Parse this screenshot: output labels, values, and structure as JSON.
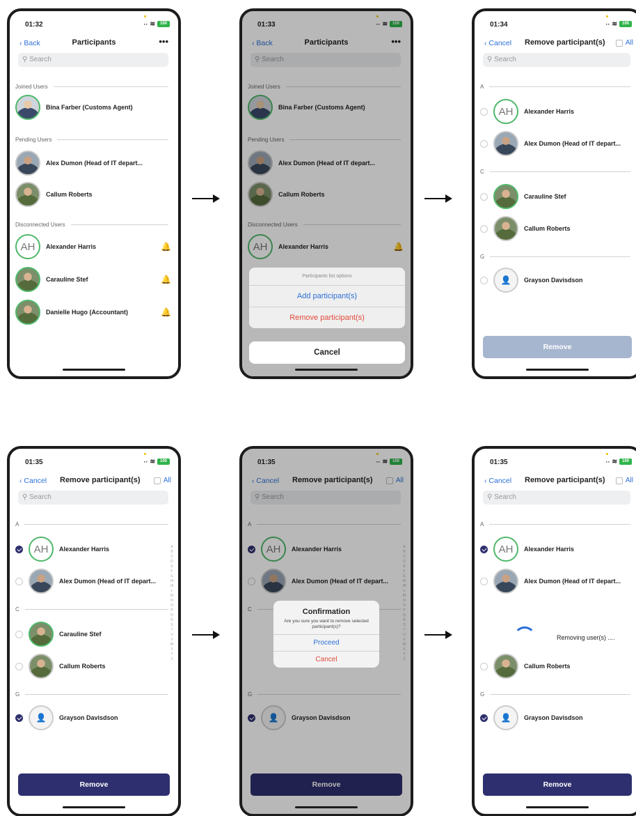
{
  "battery": "100",
  "screens": [
    {
      "time": "01:32",
      "back": "Back",
      "title": "Participants",
      "more": "•••",
      "search": "Search",
      "sections": {
        "joined": "Joined Users",
        "pending": "Pending Users",
        "disconnected": "Disconnected Users"
      },
      "users": [
        "Bina Farber (Customs Agent)",
        "Alex Dumon  (Head of IT depart...",
        "Callum Roberts",
        "Alexander Harris",
        "Carauline Stef",
        "Danielle Hugo  (Accountant)"
      ],
      "initials": "AH"
    },
    {
      "time": "01:33",
      "back": "Back",
      "title": "Participants",
      "more": "•••",
      "search": "Search",
      "sections": {
        "joined": "Joined Users",
        "pending": "Pending Users",
        "disconnected": "Disconnected Users"
      },
      "users": [
        "Bina Farber (Customs Agent)",
        "Alex Dumon  (Head of IT depart...",
        "Callum Roberts",
        "Alexander Harris"
      ],
      "initials": "AH",
      "sheet": {
        "title": "Participants list options",
        "add": "Add participant(s)",
        "remove": "Remove participant(s)",
        "cancel": "Cancel"
      }
    },
    {
      "time": "01:34",
      "back": "Cancel",
      "title": "Remove participant(s)",
      "all": "All",
      "search": "Search",
      "letters": [
        "A",
        "C",
        "G"
      ],
      "users": [
        "Alexander Harris",
        "Alex Dumon  (Head of IT depart...",
        "Carauline Stef",
        "Callum Roberts",
        "Grayson Davisdson"
      ],
      "initials": "AH",
      "button": "Remove"
    },
    {
      "time": "01:35",
      "back": "Cancel",
      "title": "Remove participant(s)",
      "all": "All",
      "search": "Search",
      "letters": [
        "A",
        "C",
        "G"
      ],
      "users": [
        "Alexander Harris",
        "Alex Dumon  (Head of IT depart...",
        "Carauline Stef",
        "Callum Roberts",
        "Grayson Davisdson"
      ],
      "initials": "AH",
      "button": "Remove",
      "alpha": "ABCDEFGHIJKLMNOPQRSTUVWXYZ"
    },
    {
      "time": "01:35",
      "back": "Cancel",
      "title": "Remove participant(s)",
      "all": "All",
      "search": "Search",
      "letters": [
        "A",
        "C",
        "G"
      ],
      "users": [
        "Alexander Harris",
        "Alex Dumon  (Head of IT depart...",
        "Grayson Davisdson"
      ],
      "initials": "AH",
      "button": "Remove",
      "alpha": "ABCDEFGHIJKLMNOPQRSTUVWXYZ",
      "modal": {
        "title": "Confirmation",
        "message": "Are you sure you want to remove selected participant(s)?",
        "proceed": "Proceed",
        "cancel": "Cancel"
      }
    },
    {
      "time": "01:35",
      "back": "Cancel",
      "title": "Remove participant(s)",
      "all": "All",
      "search": "Search",
      "letters": [
        "A",
        "C",
        "G"
      ],
      "users": [
        "Alexander Harris",
        "Alex Dumon  (Head of IT depart...",
        "Callum Roberts",
        "Grayson Davisdson"
      ],
      "initials": "AH",
      "button": "Remove",
      "toast": "Removing user(s) ...."
    }
  ]
}
